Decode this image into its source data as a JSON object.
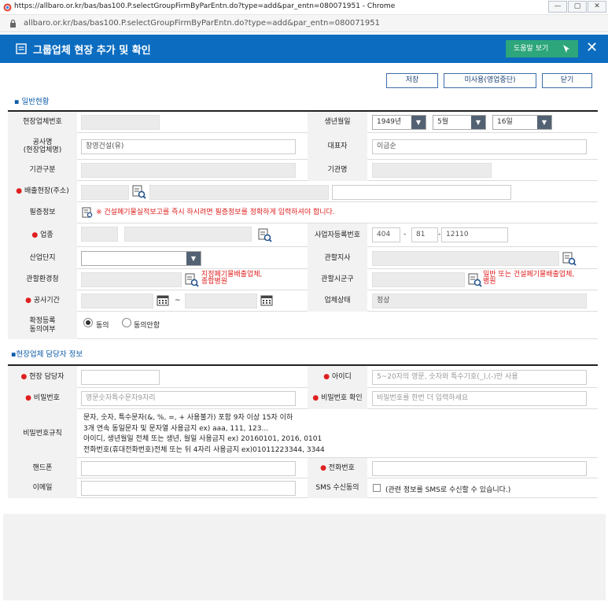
{
  "window": {
    "title": "https://allbaro.or.kr/bas/bas100.P.selectGroupFirmByParEntn.do?type=add&par_entn=080071951 - Chrome",
    "url": "allbaro.or.kr/bas/bas100.P.selectGroupFirmByParEntn.do?type=add&par_entn=080071951",
    "min": "—",
    "max": "▢",
    "close": "✕"
  },
  "header": {
    "title": "그룹업체 현장 추가 및 확인",
    "help": "도움말 보기",
    "close": "✕"
  },
  "toolbar": {
    "save": "저장",
    "unused": "미사용(영업중단)",
    "close": "닫기"
  },
  "section1": {
    "title": "일반현황"
  },
  "labels": {
    "site_no": "현장업체번호",
    "birth": "생년월일",
    "company_line1": "공사명",
    "company_line2": "(현장업체명)",
    "ceo": "대표자",
    "agency_type": "기관구분",
    "agency_name": "기관명",
    "discharge_site": "배출현장(주소)",
    "required_info": "필증정보",
    "business_type": "업종",
    "business_reg": "사업자등록번호",
    "industrial_complex": "산업단지",
    "branch": "관할지사",
    "env_office": "관할환경청",
    "city": "관할시군구",
    "period": "공사기간",
    "status": "업체상태",
    "consent_line1": "확정등록",
    "consent_line2": "동의여부"
  },
  "values": {
    "birth_year": "1949년",
    "birth_month": "5월",
    "birth_day": "16일",
    "company": "창영건설(유)",
    "ceo": "이금순",
    "required_notice": "※ 건설폐기물실적보고를 즉시 하시려면 필증정보를 정확하게 입력하셔야 합니다.",
    "reg1": "404",
    "reg2": "81",
    "reg3": "12110",
    "dash": "-",
    "tilde": "~",
    "env_note_line1": "지정폐기물배출업체,",
    "env_note_line2": "종합병원",
    "city_note_line1": "일반 또는 건설폐기물배출업체,",
    "city_note_line2": "병원",
    "status": "정상",
    "consent_yes": "동의",
    "consent_no": "동의안함"
  },
  "section2": {
    "title": "▪현장업체 담당자 정보"
  },
  "labels2": {
    "manager": "현장 담당자",
    "user_id": "아이디",
    "password": "비밀번호",
    "password_confirm": "비밀번호 확인",
    "pw_rule": "비밀번호규칙",
    "mobile": "핸드폰",
    "phone": "전화번호",
    "email": "이메일",
    "sms": "SMS 수신동의"
  },
  "placeholders": {
    "user_id": "5~20자의 영문, 숫자와 특수기호(_),(-)만 사용",
    "password": "영문숫자특수문자9자리",
    "password_confirm": "비밀번호를 한번 더 입력하세요"
  },
  "pw_rules": [
    "문자, 숫자, 특수문자(&, %, =, + 사용불가) 포함 9자 이상 15자 이하",
    "3개 연속 동일문자 및 문자열 사용금지 ex) aaa, 111, 123...",
    "아이디, 생년월일 전체 또는 생년, 월일 사용금지 ex) 20160101, 2016, 0101",
    "전화번호(휴대전화번호)전체 또는 뒤 4자리 사용금지 ex)01011223344, 3344"
  ],
  "sms_text": "(관련 정보를 SMS로 수신할 수 있습니다.)",
  "dot": "●"
}
